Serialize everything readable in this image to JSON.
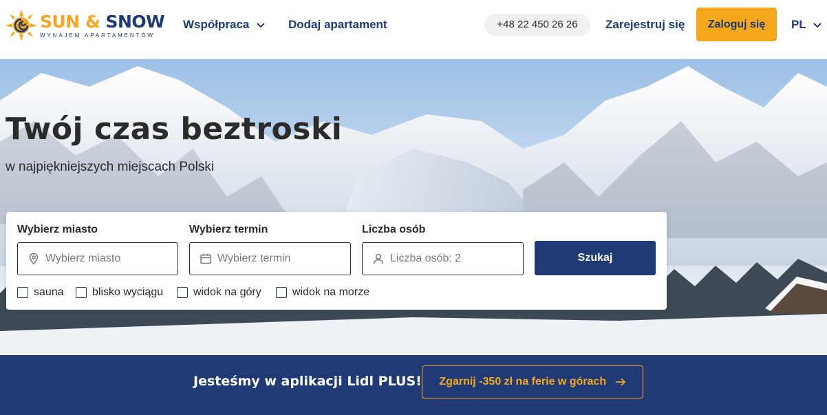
{
  "brand": {
    "title_part1": "SUN",
    "title_amp": "&",
    "title_part2": "SNOW",
    "subtitle": "WYNAJEM APARTAMENTÓW",
    "primary_color": "#1f3a75",
    "accent_color": "#f6a81c"
  },
  "nav": {
    "collaboration": "Współpraca",
    "add_apartment": "Dodaj apartament",
    "phone": "+48 22 450 26 26",
    "register": "Zarejestruj się",
    "login": "Zaloguj się",
    "language": "PL"
  },
  "hero": {
    "title": "Twój czas beztroski",
    "subtitle": "w najpiękniejszych miejscach Polski"
  },
  "search": {
    "city_label": "Wybierz miasto",
    "city_placeholder": "Wybierz miasto",
    "date_label": "Wybierz termin",
    "date_placeholder": "Wybierz termin",
    "guests_label": "Liczba osób",
    "guests_value": "Liczba osób: 2",
    "submit": "Szukaj",
    "filters": [
      "sauna",
      "blisko wyciągu",
      "widok na góry",
      "widok na morze"
    ]
  },
  "banner": {
    "text": "Jesteśmy w aplikacji Lidl PLUS!",
    "cta": "Zgarnij -350 zł na ferie w górach"
  }
}
